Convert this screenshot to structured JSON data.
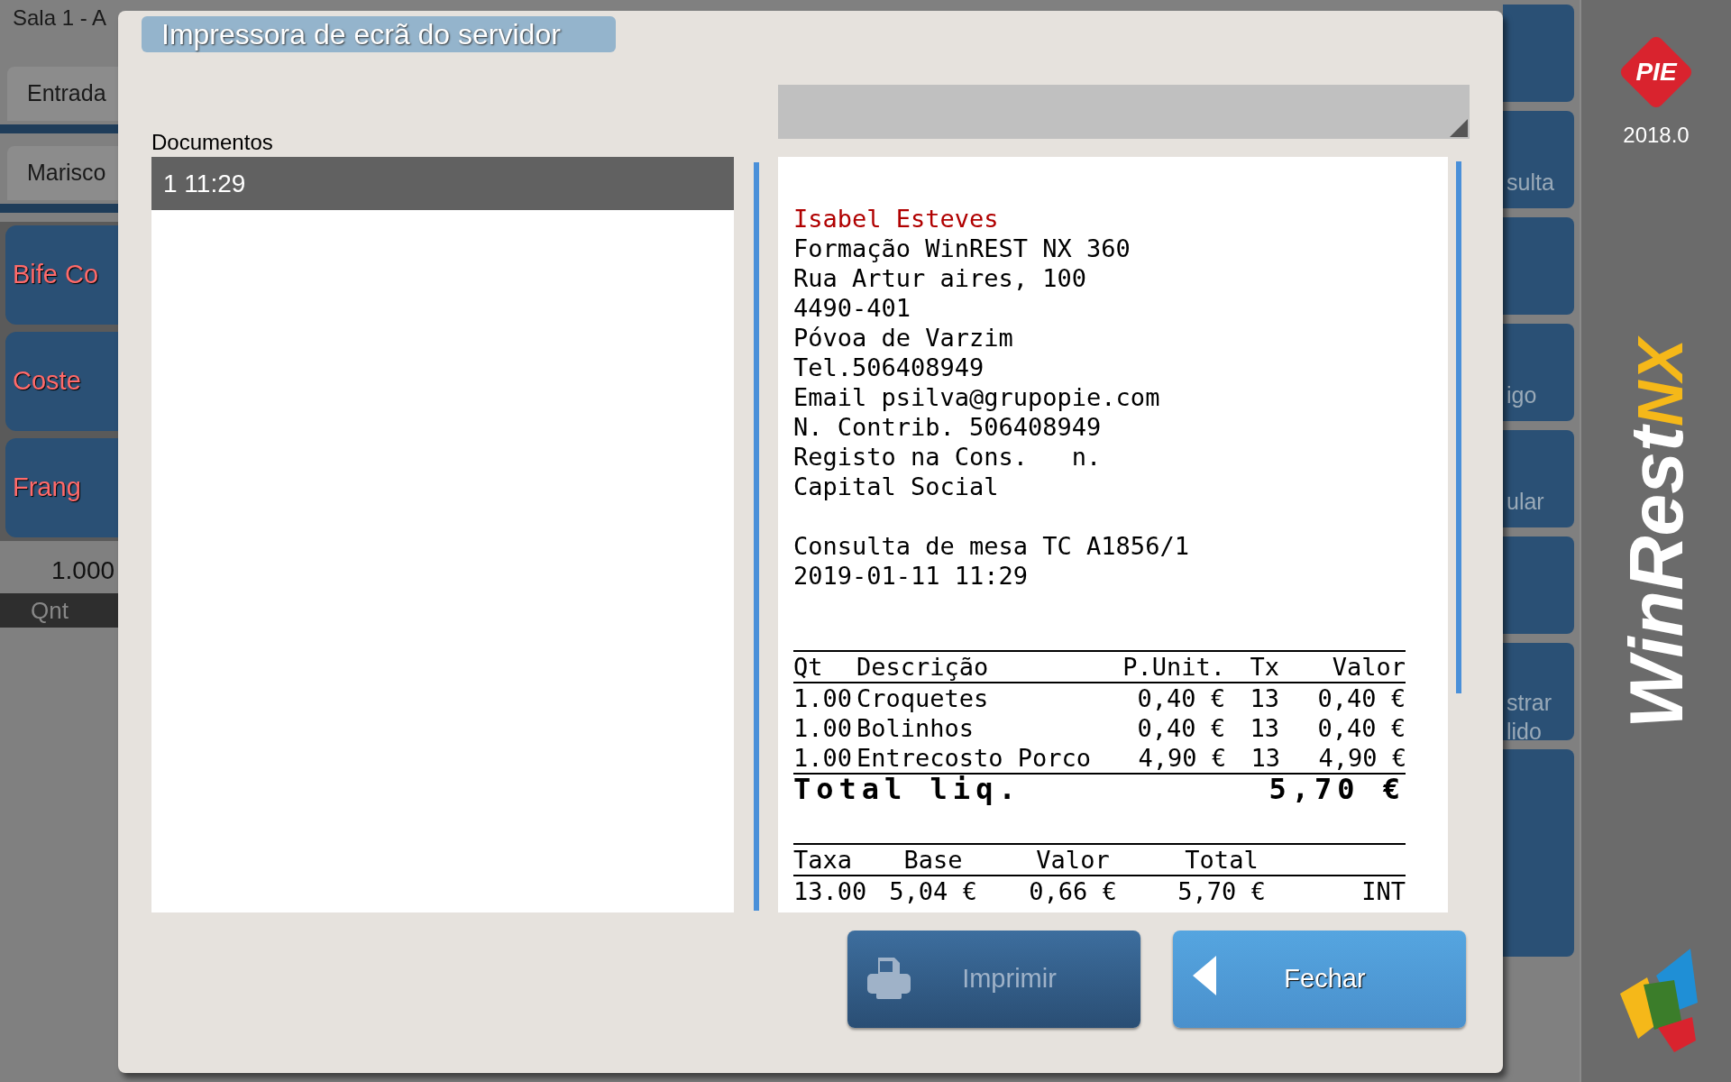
{
  "background": {
    "title": "Sala 1 - A",
    "tabs": [
      "Entrada",
      "Marisco"
    ],
    "products": [
      "Bife Co",
      "Coste",
      "Frang"
    ],
    "quantity": "1.000",
    "column_header": "Qnt",
    "side_buttons": [
      {
        "kind": "icon"
      },
      {
        "kind": "text",
        "label": "sulta"
      },
      {
        "kind": "icon"
      },
      {
        "kind": "text",
        "label": "igo"
      },
      {
        "kind": "text",
        "label": "ular"
      },
      {
        "kind": "icon"
      },
      {
        "kind": "text",
        "label": "strar\nlido"
      },
      {
        "kind": "tall"
      }
    ]
  },
  "brand": {
    "logo": "PIE",
    "version": "2018.0",
    "name": "WinRest",
    "suffix": "NX"
  },
  "dialog": {
    "title": "Impressora de ecrã do servidor",
    "documents": {
      "label": "Documentos",
      "items": [
        {
          "text": "1 11:29",
          "selected": true
        }
      ]
    },
    "receipt": {
      "company": [
        "Isabel Esteves",
        "Formação WinREST NX 360",
        "Rua Artur aires, 100",
        "4490-401",
        "Póvoa de Varzim",
        "Tel.506408949",
        "Email psilva@grupopie.com",
        "N. Contrib. 506408949",
        "Registo na Cons.   n.",
        "Capital Social"
      ],
      "document": [
        "Consulta de mesa TC A1856/1",
        "2019-01-11 11:29"
      ],
      "columns": [
        "Qt",
        "Descrição",
        "P.Unit.",
        "Tx",
        "Valor"
      ],
      "rows": [
        [
          "1.00",
          "Croquetes",
          "0,40 €",
          "13",
          "0,40 €"
        ],
        [
          "1.00",
          "Bolinhos",
          "0,40 €",
          "13",
          "0,40 €"
        ],
        [
          "1.00",
          "Entrecosto Porco",
          "4,90 €",
          "13",
          "4,90 €"
        ]
      ],
      "total_label": "Total liq.",
      "total_value": "5,70 €",
      "tax_columns": [
        "Taxa",
        "Base",
        "Valor",
        "Total"
      ],
      "tax_rows": [
        [
          "13.00",
          "5,04 €",
          "0,66 €",
          "5,70 €",
          "INT"
        ]
      ]
    },
    "buttons": [
      {
        "label": "Imprimir",
        "kind": "print",
        "disabled": true
      },
      {
        "label": "Fechar",
        "kind": "back",
        "disabled": false
      }
    ]
  }
}
